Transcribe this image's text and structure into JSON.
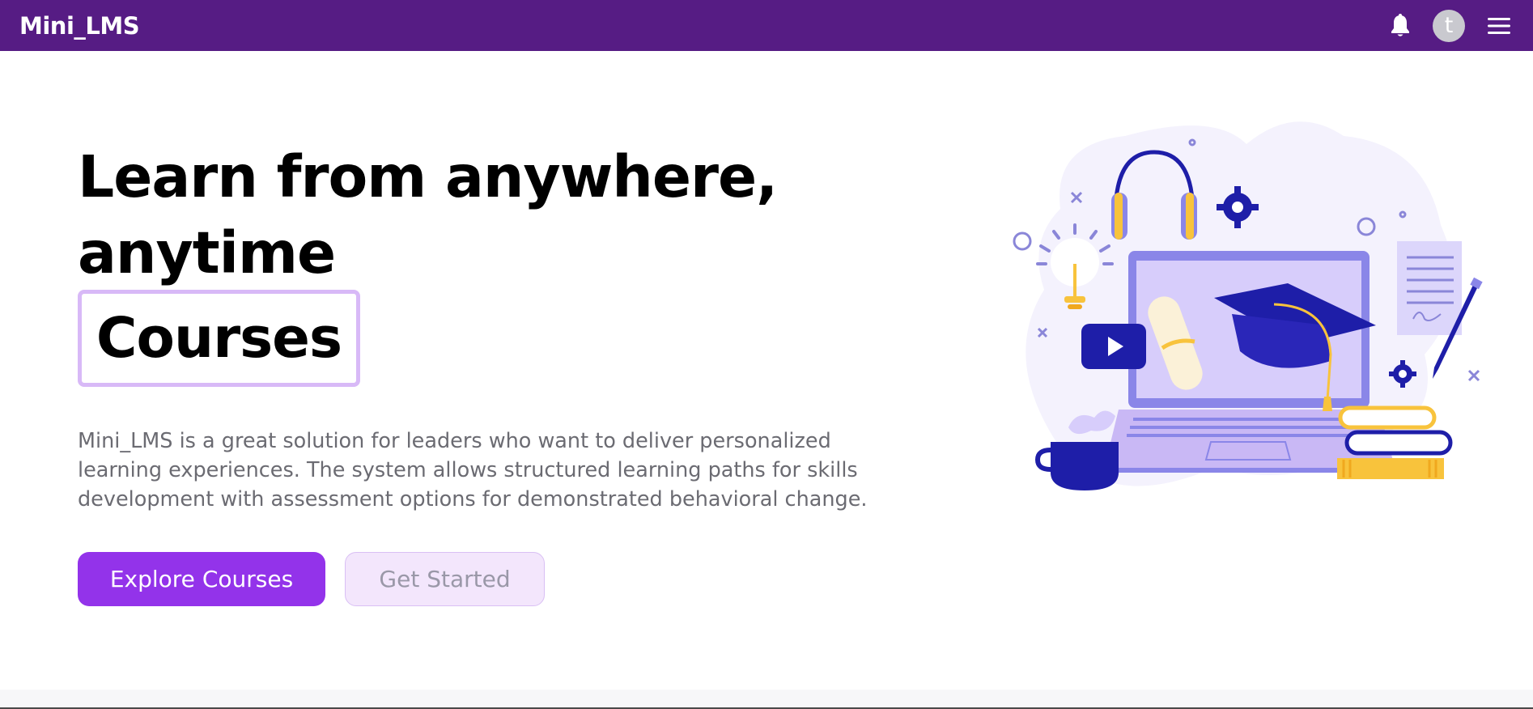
{
  "navbar": {
    "brand": "Mini_LMS",
    "avatar_initial": "t",
    "icons": [
      "bell-icon",
      "hamburger-menu-icon"
    ],
    "background": "#561c84"
  },
  "hero": {
    "title_line1": "Learn from anywhere,",
    "title_line2": "anytime",
    "typed_word": "Courses",
    "description": "Mini_LMS is a great solution for leaders who want to deliver personalized learning experiences. The system allows structured learning paths for skills development with assessment options for demonstrated behavioral change.",
    "primary_button": "Explore Courses",
    "secondary_button": "Get Started"
  },
  "colors": {
    "accent": "#9333ea",
    "accent_light": "#f3e6fc",
    "typed_border": "#d8b9f7",
    "illustration_primary": "#1e1ea8",
    "illustration_light": "#c9b8f5",
    "illustration_yellow": "#f8c33c"
  }
}
